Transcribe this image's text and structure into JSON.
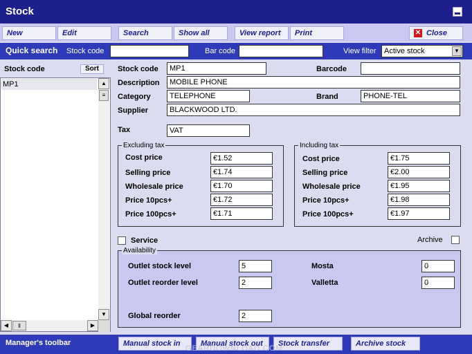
{
  "window": {
    "title": "Stock"
  },
  "toolbar": {
    "new": "New",
    "edit": "Edit",
    "search": "Search",
    "show_all": "Show all",
    "view_report": "View report",
    "print": "Print",
    "close": "Close"
  },
  "quick_search": {
    "label": "Quick search",
    "stock_code_label": "Stock code",
    "stock_code_value": "",
    "bar_code_label": "Bar code",
    "bar_code_value": "",
    "view_filter_label": "View filter",
    "view_filter_value": "Active stock"
  },
  "list": {
    "header": "Stock code",
    "sort_label": "Sort",
    "items": [
      "MP1"
    ]
  },
  "form": {
    "stock_code_label": "Stock code",
    "stock_code": "MP1",
    "barcode_label": "Barcode",
    "barcode": "",
    "description_label": "Description",
    "description": "MOBILE PHONE",
    "category_label": "Category",
    "category": "TELEPHONE",
    "brand_label": "Brand",
    "brand": "PHONE-TEL",
    "supplier_label": "Supplier",
    "supplier": "BLACKWOOD LTD.",
    "tax_label": "Tax",
    "tax": "VAT"
  },
  "excl": {
    "title": "Excluding tax",
    "cost_label": "Cost price",
    "cost": "€1.52",
    "selling_label": "Selling price",
    "selling": "€1.74",
    "wholesale_label": "Wholesale price",
    "wholesale": "€1.70",
    "p10_label": "Price 10pcs+",
    "p10": "€1.72",
    "p100_label": "Price 100pcs+",
    "p100": "€1.71"
  },
  "incl": {
    "title": "Including tax",
    "cost_label": "Cost price",
    "cost": "€1.75",
    "selling_label": "Selling price",
    "selling": "€2.00",
    "wholesale_label": "Wholesale price",
    "wholesale": "€1.95",
    "p10_label": "Price 10pcs+",
    "p10": "€1.98",
    "p100_label": "Price 100pcs+",
    "p100": "€1.97"
  },
  "options": {
    "service_label": "Service",
    "archive_label": "Archive"
  },
  "availability": {
    "title": "Availability",
    "outlet_stock_label": "Outlet stock level",
    "outlet_stock": "5",
    "outlet_reorder_label": "Outlet reorder level",
    "outlet_reorder": "2",
    "global_reorder_label": "Global reorder",
    "global_reorder": "2",
    "mosta_label": "Mosta",
    "mosta": "0",
    "valletta_label": "Valletta",
    "valletta": "0"
  },
  "manager": {
    "label": "Manager's toolbar",
    "manual_in": "Manual stock in",
    "manual_out": "Manual stock out",
    "transfer": "Stock transfer",
    "archive": "Archive stock"
  },
  "watermark": "GEARDOWNLOAD.COM"
}
